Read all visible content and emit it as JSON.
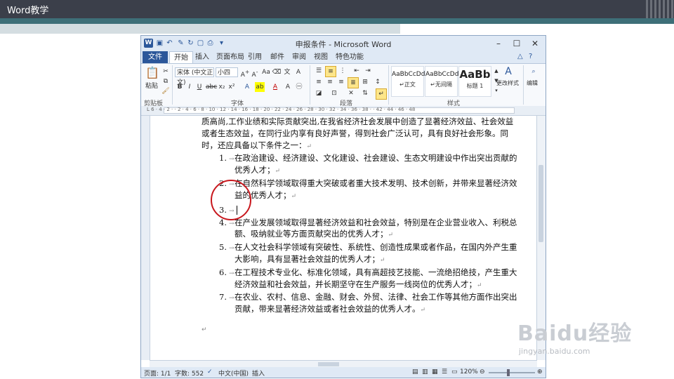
{
  "slide": {
    "title": "Word教学"
  },
  "window": {
    "title": "申报条件 - Microsoft Word",
    "minimize": "–",
    "maximize": "☐",
    "close": "✕"
  },
  "ribbon_tabs": [
    "文件",
    "开始",
    "插入",
    "页面布局",
    "引用",
    "邮件",
    "审阅",
    "视图",
    "特色功能"
  ],
  "ribbon": {
    "paste_label": "粘贴",
    "font_name": "宋体 (中文正文)",
    "font_size": "小四",
    "group_clipboard": "剪贴板",
    "group_font": "字体",
    "group_paragraph": "段落",
    "group_styles": "样式",
    "styles": [
      {
        "sample": "AaBbCcDd",
        "name": "↵正文"
      },
      {
        "sample": "AaBbCcDd",
        "name": "↵无间隔"
      },
      {
        "sample": "AaBb",
        "name": "标题 1"
      }
    ],
    "change_styles_label": "更改样式",
    "edit_label": "编辑"
  },
  "ruler_numbers": "L  6 · 4 · 2 ·    · 2 · 4 · 6 · 8 · 10 · 12 · 14 · 16 · 18 · 20 · 22 · 24 · 26 · 28 · 30 · 32 · 34 · 36 · 38 ·    · 42 · 44 · 46 · 48",
  "document": {
    "intro": "质高尚,工作业绩和实际贡献突出,在我省经济社会发展中创造了显著经济效益、社会效益或者生态效益，在同行业内享有良好声誉，得到社会广泛认可，具有良好社会形象。同时，还应具备以下条件之一：",
    "items": [
      {
        "num": "1.",
        "text": "在政治建设、经济建设、文化建设、社会建设、生态文明建设中作出突出贡献的优秀人才；"
      },
      {
        "num": "2.",
        "text": "在自然科学领域取得重大突破或者重大技术发明、技术创新，并带来显著经济效益的优秀人才；"
      },
      {
        "num": "3.",
        "text": ""
      },
      {
        "num": "4.",
        "text": "在产业发展领域取得显著经济效益和社会效益，特别是在企业营业收入、利税总额、吸纳就业等方面贡献突出的优秀人才；"
      },
      {
        "num": "5.",
        "text": "在人文社会科学领域有突破性、系统性、创造性成果或者作品，在国内外产生重大影响，具有显著社会效益的优秀人才；"
      },
      {
        "num": "6.",
        "text": "在工程技术专业化、标准化领域，具有高超技艺技能、一流绝招绝技，产生重大经济效益和社会效益，并长期坚守在生产服务一线岗位的优秀人才；"
      },
      {
        "num": "7.",
        "text": "在农业、农村、信息、金融、财会、外贸、法律、社会工作等其他方面作出突出贡献，带来显著经济效益或者社会效益的优秀人才。"
      }
    ]
  },
  "status_bar": {
    "page": "页面: 1/1",
    "words": "字数: 552",
    "language": "中文(中国)",
    "mode": "插入",
    "zoom": "120%",
    "zoom_level_percent": 120
  },
  "watermark": {
    "main": "Baidu经验",
    "url": "jingyan.baidu.com"
  },
  "colors": {
    "slide_header": "#3b3f4a",
    "slide_teal": "#3e6f78",
    "word_blue": "#2b579a",
    "annotation_red": "#c8171d"
  }
}
